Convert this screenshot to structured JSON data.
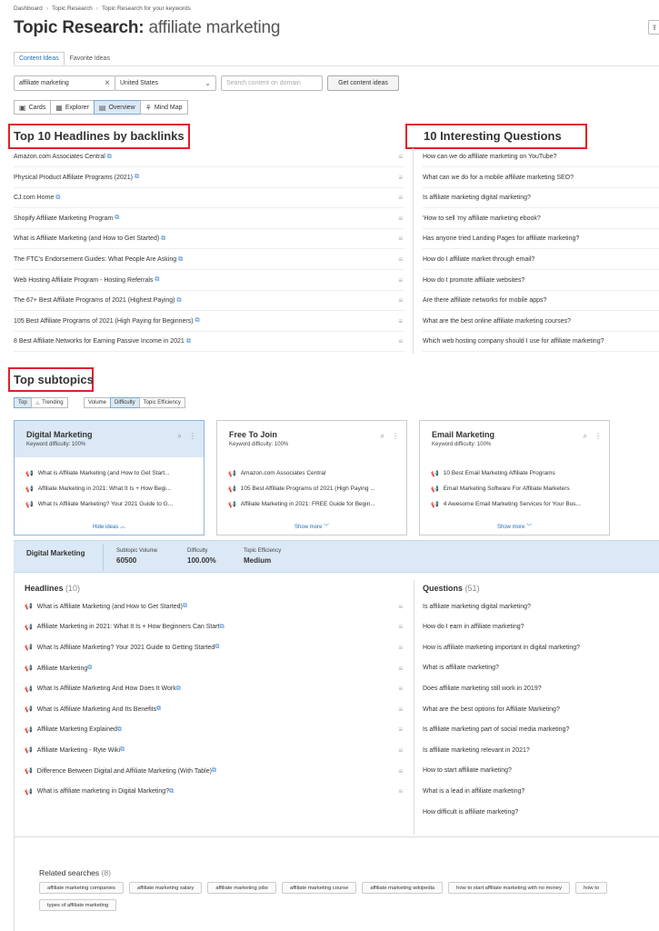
{
  "breadcrumbs": [
    "Dashboard",
    "Topic Research",
    "Topic Research for your keywords"
  ],
  "page_title": {
    "prefix": "Topic Research:",
    "keyword": "affiliate marketing"
  },
  "tabs": [
    {
      "label": "Content Ideas",
      "active": true
    },
    {
      "label": "Favorite Ideas",
      "active": false
    }
  ],
  "search": {
    "keyword_value": "affiliate marketing",
    "country_value": "United States",
    "domain_placeholder": "Search content on domain",
    "submit_label": "Get content ideas"
  },
  "views": [
    {
      "label": "Cards",
      "icon": "cards-icon",
      "active": false
    },
    {
      "label": "Explorer",
      "icon": "table-icon",
      "active": false
    },
    {
      "label": "Overview",
      "icon": "overview-icon",
      "active": true
    },
    {
      "label": "Mind Map",
      "icon": "mindmap-icon",
      "active": false
    }
  ],
  "headlines_section": {
    "title": "Top 10 Headlines by backlinks",
    "items": [
      "Amazon.com Associates Central",
      "Physical Product Affiliate Programs (2021)",
      "CJ.com Home",
      "Shopify Affiliate Marketing Program",
      "What is Affiliate Marketing (and How to Get Started)",
      "The FTC's Endorsement Guides: What People Are Asking",
      "Web Hosting Affiliate Program - Hosting Referrals",
      "The 67+ Best Affiliate Programs of 2021 (Highest Paying)",
      "105 Best Affiliate Programs of 2021 (High Paying for Beginners)",
      "8 Best Affiliate Networks for Earning Passive Income in 2021"
    ]
  },
  "questions_section": {
    "title": "10 Interesting Questions",
    "items": [
      "How can we do affiliate marketing on YouTube?",
      "What can we do for a mobile affiliate marketing SEO?",
      "Is affiliate marketing digital marketing?",
      "'How to sell 'my affiliate marketing ebook?",
      "Has anyone tried Landing Pages for affiliate marketing?",
      "How do I affiliate market through email?",
      "How do I promote affiliate websites?",
      "Are there affiliate networks for mobile apps?",
      "What are the best online affiliate marketing courses?",
      "Which web hosting company should I use for affiliate marketing?"
    ]
  },
  "subtopics": {
    "title": "Top subtopics",
    "sort_left": [
      {
        "label": "Top",
        "active": true
      },
      {
        "label": "Trending",
        "active": false
      }
    ],
    "sort_right": [
      {
        "label": "Volume",
        "active": false
      },
      {
        "label": "Difficulty",
        "active": true
      },
      {
        "label": "Topic Efficiency",
        "active": false
      }
    ],
    "cards": [
      {
        "title": "Digital Marketing",
        "difficulty": "Keyword difficulty: 100%",
        "items": [
          "What is Affiliate Marketing (and How to Get Start...",
          "Affiliate Marketing in 2021: What It Is + How Begi...",
          "What Is Affiliate Marketing? Your 2021 Guide to G..."
        ],
        "toggle": "Hide ideas",
        "selected": true
      },
      {
        "title": "Free To Join",
        "difficulty": "Keyword difficulty: 100%",
        "items": [
          "Amazon.com Associates Central",
          "105 Best Affiliate Programs of 2021 (High Paying ...",
          "Affiliate Marketing in 2021: FREE Guide for Begin..."
        ],
        "toggle": "Show more",
        "selected": false
      },
      {
        "title": "Email Marketing",
        "difficulty": "Keyword difficulty: 100%",
        "items": [
          "10 Best Email Marketing Affiliate Programs",
          "Email Marketing Software For Affiliate Marketers",
          "4 Awesome Email Marketing Services for Your Bus..."
        ],
        "toggle": "Show more",
        "selected": false
      }
    ]
  },
  "detail": {
    "name": "Digital Marketing",
    "stats": [
      {
        "label": "Subtopic Volume",
        "value": "60500"
      },
      {
        "label": "Difficulty",
        "value": "100.00%"
      },
      {
        "label": "Topic Efficiency",
        "value": "Medium"
      }
    ],
    "headlines_label": "Headlines",
    "headlines_count": "(10)",
    "headlines": [
      "What is Affiliate Marketing (and How to Get Started)",
      "Affiliate Marketing in 2021: What It Is + How Beginners Can Start",
      "What Is Affiliate Marketing? Your 2021 Guide to Getting Started",
      "Affiliate Marketing",
      "What Is Affiliate Marketing And How Does It Work",
      "What Is Affiliate Marketing And Its Benefits",
      "Affiliate Marketing Explained",
      "Affiliate Marketing - Ryte Wiki",
      "Difference Between Digital and Affiliate Marketing (With Table)",
      "What is affiliate marketing in Digital Marketing?"
    ],
    "questions_label": "Questions",
    "questions_count": "(51)",
    "questions": [
      "Is affiliate marketing digital marketing?",
      "How do I earn in affiliate marketing?",
      "How is affiliate marketing important in digital marketing?",
      "What is affiliate marketing?",
      "Does affiliate marketing still work in 2019?",
      "What are the best options for Affiliate Marketing?",
      "Is affiliate marketing part of social media marketing?",
      "Is affiliate marketing relevant in 2021?",
      "How to start affiliate marketing?",
      "What is a lead in affiliate marketing?",
      "How difficult is affiliate marketing?"
    ]
  },
  "related": {
    "label": "Related searches",
    "count": "(8)",
    "chips": [
      "affiliate marketing companies",
      "affiliate marketing salary",
      "affiliate marketing jobs",
      "affiliate marketing course",
      "affiliate marketing wikipedia",
      "how to start affiliate marketing with no money",
      "how to",
      "types of affiliate marketing"
    ]
  },
  "colors": {
    "accent": "#1a6fbf",
    "highlight_box": "#e0202a",
    "selected_bg": "#dbe8f5"
  }
}
